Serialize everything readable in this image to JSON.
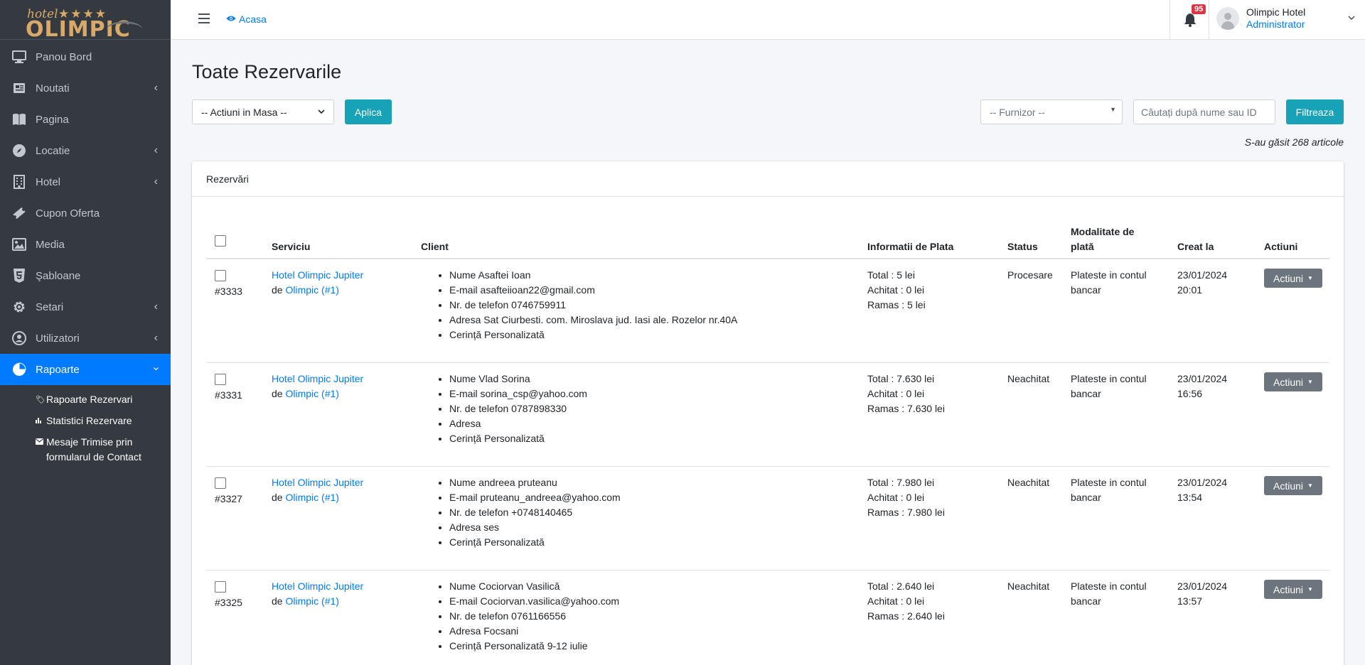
{
  "brand": {
    "small": "hotel",
    "stars": "★★★★",
    "big": "OLIMPIC"
  },
  "sidebar": {
    "items": [
      {
        "label": "Panou Bord",
        "icon": "desktop-icon",
        "chevron": false,
        "active": false
      },
      {
        "label": "Noutati",
        "icon": "newspaper-icon",
        "chevron": true,
        "active": false
      },
      {
        "label": "Pagina",
        "icon": "book-icon",
        "chevron": false,
        "active": false
      },
      {
        "label": "Locatie",
        "icon": "compass-icon",
        "chevron": true,
        "active": false
      },
      {
        "label": "Hotel",
        "icon": "building-icon",
        "chevron": true,
        "active": false
      },
      {
        "label": "Cupon Oferta",
        "icon": "ticket-icon",
        "chevron": false,
        "active": false
      },
      {
        "label": "Media",
        "icon": "image-icon",
        "chevron": false,
        "active": false
      },
      {
        "label": "Şabloane",
        "icon": "html5-icon",
        "chevron": false,
        "active": false
      },
      {
        "label": "Setari",
        "icon": "gear-icon",
        "chevron": true,
        "active": false
      },
      {
        "label": "Utilizatori",
        "icon": "users-icon",
        "chevron": true,
        "active": false
      },
      {
        "label": "Rapoarte",
        "icon": "pie-chart-icon",
        "chevron": true,
        "active": true
      }
    ],
    "subitems": [
      {
        "label": "Rapoarte Rezervari",
        "icon": "tags-icon"
      },
      {
        "label": "Statistici Rezervare",
        "icon": "bar-chart-icon"
      },
      {
        "label": "Mesaje Trimise prin formularul de Contact",
        "icon": "envelope-icon"
      }
    ]
  },
  "topbar": {
    "home_label": "Acasa",
    "notifications_count": "95",
    "user_name": "Olimpic Hotel",
    "user_role": "Administrator"
  },
  "page": {
    "title": "Toate Rezervarile",
    "bulk_actions_selected": "-- Actiuni in Masa --",
    "apply_label": "Aplica",
    "supplier_placeholder": "-- Furnizor --",
    "search_placeholder": "Căutați după nume sau ID",
    "filter_label": "Filtreaza",
    "results_count": "S-au găsit 268 articole",
    "card_title": "Rezervări"
  },
  "table": {
    "headers": {
      "service": "Serviciu",
      "client": "Client",
      "payment_info": "Informatii de Plata",
      "status": "Status",
      "payment_method_1": "Modalitate de",
      "payment_method_2": "plată",
      "created": "Creat la",
      "actions": "Actiuni"
    },
    "rows": [
      {
        "id": "#3333",
        "service": "Hotel Olimpic Jupiter",
        "by": "de",
        "supplier": "Olimpic (#1)",
        "client": [
          "Nume Asaftei Ioan",
          "E-mail asafteiioan22@gmail.com",
          "Nr. de telefon 0746759911",
          "Adresa Sat Ciurbesti. com. Miroslava jud. Iasi ale. Rozelor nr.40A",
          "Cerință Personalizată"
        ],
        "total": "Total : 5 lei",
        "paid": "Achitat : 0 lei",
        "remaining": "Ramas : 5 lei",
        "status": "Procesare",
        "method_1": "Plateste in contul",
        "method_2": "bancar",
        "date": "23/01/2024",
        "time": "20:01",
        "action": "Actiuni"
      },
      {
        "id": "#3331",
        "service": "Hotel Olimpic Jupiter",
        "by": "de",
        "supplier": "Olimpic (#1)",
        "client": [
          "Nume Vlad Sorina",
          "E-mail sorina_csp@yahoo.com",
          "Nr. de telefon 0787898330",
          "Adresa",
          "Cerință Personalizată"
        ],
        "total": "Total : 7.630 lei",
        "paid": "Achitat : 0 lei",
        "remaining": "Ramas : 7.630 lei",
        "status": "Neachitat",
        "method_1": "Plateste in contul",
        "method_2": "bancar",
        "date": "23/01/2024",
        "time": "16:56",
        "action": "Actiuni"
      },
      {
        "id": "#3327",
        "service": "Hotel Olimpic Jupiter",
        "by": "de",
        "supplier": "Olimpic (#1)",
        "client": [
          "Nume andreea pruteanu",
          "E-mail pruteanu_andreea@yahoo.com",
          "Nr. de telefon +0748140465",
          "Adresa ses",
          "Cerință Personalizată"
        ],
        "total": "Total : 7.980 lei",
        "paid": "Achitat : 0 lei",
        "remaining": "Ramas : 7.980 lei",
        "status": "Neachitat",
        "method_1": "Plateste in contul",
        "method_2": "bancar",
        "date": "23/01/2024",
        "time": "13:54",
        "action": "Actiuni"
      },
      {
        "id": "#3325",
        "service": "Hotel Olimpic Jupiter",
        "by": "de",
        "supplier": "Olimpic (#1)",
        "client": [
          "Nume Cociorvan Vasilică",
          "E-mail Cociorvan.vasilica@yahoo.com",
          "Nr. de telefon 0761166556",
          "Adresa Focsani",
          "Cerință Personalizată 9-12 iulie"
        ],
        "total": "Total : 2.640 lei",
        "paid": "Achitat : 0 lei",
        "remaining": "Ramas : 2.640 lei",
        "status": "Neachitat",
        "method_1": "Plateste in contul",
        "method_2": "bancar",
        "date": "23/01/2024",
        "time": "13:57",
        "action": "Actiuni"
      }
    ]
  }
}
